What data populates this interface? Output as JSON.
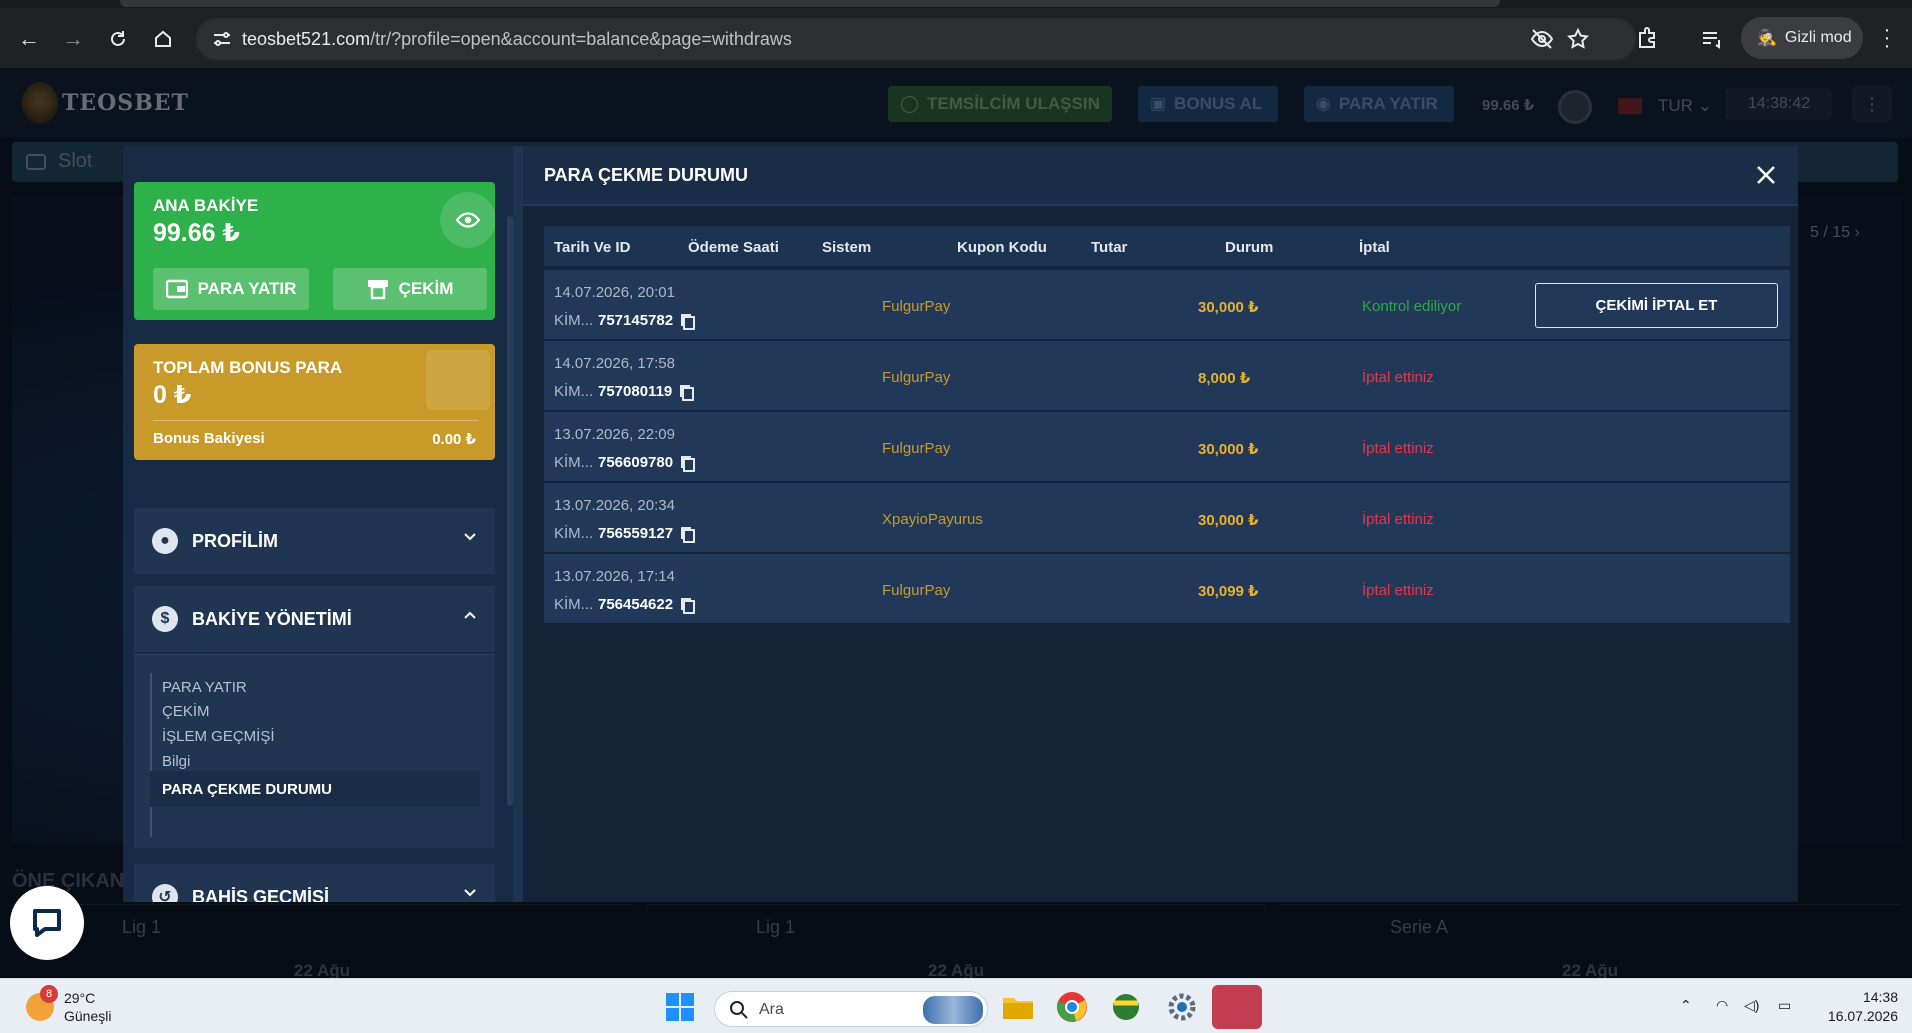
{
  "browser": {
    "url_host": "teosbet521.com",
    "url_path": "/tr/?profile=open&account=balance&page=withdraws",
    "incognito_label": "Gizli mod"
  },
  "site": {
    "logo_text": "TEOSBET",
    "contact_label": "TEMSİLCİM ULAŞSIN",
    "bonus_label": "BONUS AL",
    "deposit_label": "PARA YATIR",
    "balance": "99.66 ₺",
    "language": "TUR",
    "time": "14:38:42"
  },
  "background": {
    "slot_label": "Slot",
    "pager": "5 / 15",
    "section_title": "ÖNE ÇIKAN",
    "cards": [
      {
        "league": "Lig 1",
        "date": "22 Ağu"
      },
      {
        "league": "Lig 1",
        "date": "22 Ağu"
      },
      {
        "league": "Serie A",
        "date": "22 Ağu"
      }
    ]
  },
  "sidebar": {
    "main_balance_title": "ANA BAKİYE",
    "main_balance_value": "99.66 ₺",
    "deposit_btn": "PARA YATIR",
    "withdraw_btn": "ÇEKİM",
    "bonus_title": "TOPLAM BONUS PARA",
    "bonus_value": "0 ₺",
    "bonus_balance_label": "Bonus Bakiyesi",
    "bonus_balance_value": "0.00 ₺",
    "profile_label": "PROFİLİM",
    "balance_mgmt_label": "BAKİYE YÖNETİMİ",
    "bet_history_label": "BAHİS GEÇMİŞİ",
    "submenu": [
      "PARA YATIR",
      "ÇEKİM",
      "İŞLEM GEÇMİŞİ",
      "Bilgi",
      "PARA ÇEKME DURUMU"
    ]
  },
  "content": {
    "title": "PARA ÇEKME DURUMU",
    "columns": [
      "Tarih Ve ID",
      "Ödeme Saati",
      "Sistem",
      "Kupon Kodu",
      "Tutar",
      "Durum",
      "İptal"
    ],
    "rows": [
      {
        "date": "14.07.2026, 20:01",
        "id_prefix": "KİM...",
        "id": "757145782",
        "system": "FulgurPay",
        "amount": "30,000  ₺",
        "status": "Kontrol ediliyor",
        "status_color": "#2fa84a",
        "cancel": "ÇEKİMİ İPTAL ET"
      },
      {
        "date": "14.07.2026, 17:58",
        "id_prefix": "KİM...",
        "id": "757080119",
        "system": "FulgurPay",
        "amount": "8,000  ₺",
        "status": "İptal ettiniz",
        "status_color": "#e5364a",
        "cancel": ""
      },
      {
        "date": "13.07.2026, 22:09",
        "id_prefix": "KİM...",
        "id": "756609780",
        "system": "FulgurPay",
        "amount": "30,000  ₺",
        "status": "İptal ettiniz",
        "status_color": "#e5364a",
        "cancel": ""
      },
      {
        "date": "13.07.2026, 20:34",
        "id_prefix": "KİM...",
        "id": "756559127",
        "system": "XpayioPayurus",
        "amount": "30,000  ₺",
        "status": "İptal ettiniz",
        "status_color": "#e5364a",
        "cancel": ""
      },
      {
        "date": "13.07.2026, 17:14",
        "id_prefix": "KİM...",
        "id": "756454622",
        "system": "FulgurPay",
        "amount": "30,099  ₺",
        "status": "İptal ettiniz",
        "status_color": "#e5364a",
        "cancel": ""
      }
    ]
  },
  "taskbar": {
    "weather_temp": "29°C",
    "weather_desc": "Güneşli",
    "weather_badge": "8",
    "search_label": "Ara",
    "clock_time": "14:38",
    "clock_date": "16.07.2026"
  }
}
